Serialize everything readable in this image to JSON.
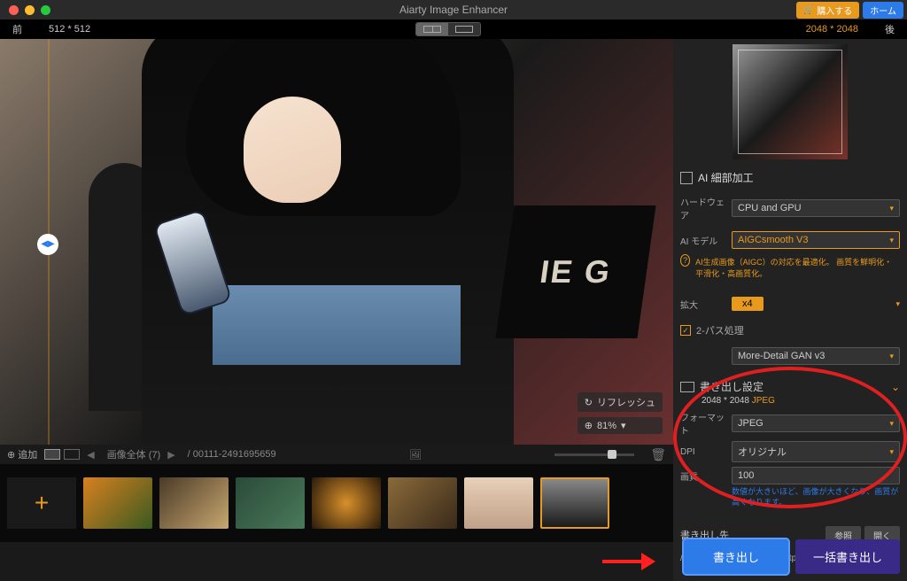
{
  "app": {
    "title": "Aiarty Image Enhancer"
  },
  "topbar": {
    "buy_label": "購入する",
    "home_label": "ホーム"
  },
  "size_header": {
    "before_label": "前",
    "before_size": "512 * 512",
    "after_size": "2048 * 2048",
    "after_label": "後"
  },
  "viewport": {
    "refresh_label": "リフレッシュ",
    "zoom_value": "81%",
    "sign_text": "IE G"
  },
  "thumb_toolbar": {
    "add_label": "追加",
    "all_images_label": "画像全体 (7)",
    "filename": "/ 00111-2491695659"
  },
  "ai_section": {
    "title": "AI 細部加工",
    "hardware_label": "ハードウェア",
    "hardware_value": "CPU and GPU",
    "model_label": "AI モデル",
    "model_value": "AIGCsmooth  V3",
    "model_hint": "AI生成画像（AIGC）の対応を最適化。\n画質を鮮明化・平滑化・高画質化。",
    "scale_label": "拡大",
    "scale_value": "x4",
    "twopass_label": "2-パス処理",
    "gan_value": "More-Detail GAN v3"
  },
  "export": {
    "title": "書き出し設定",
    "info_size": "2048 * 2048",
    "info_format": "JPEG",
    "format_label": "フォーマット",
    "format_value": "JPEG",
    "dpi_label": "DPI",
    "dpi_value": "オリジナル",
    "quality_label": "画質",
    "quality_value": "100",
    "quality_note": "数値が大きいほど、画像が大きくなり、画質が高くなります。"
  },
  "output": {
    "dest_label": "書き出し先",
    "browse_label": "参照",
    "open_label": "開く",
    "path": "/Users/tk/Pictures/Aiarty Output"
  },
  "buttons": {
    "export": "書き出し",
    "batch_export": "一括書き出し"
  }
}
